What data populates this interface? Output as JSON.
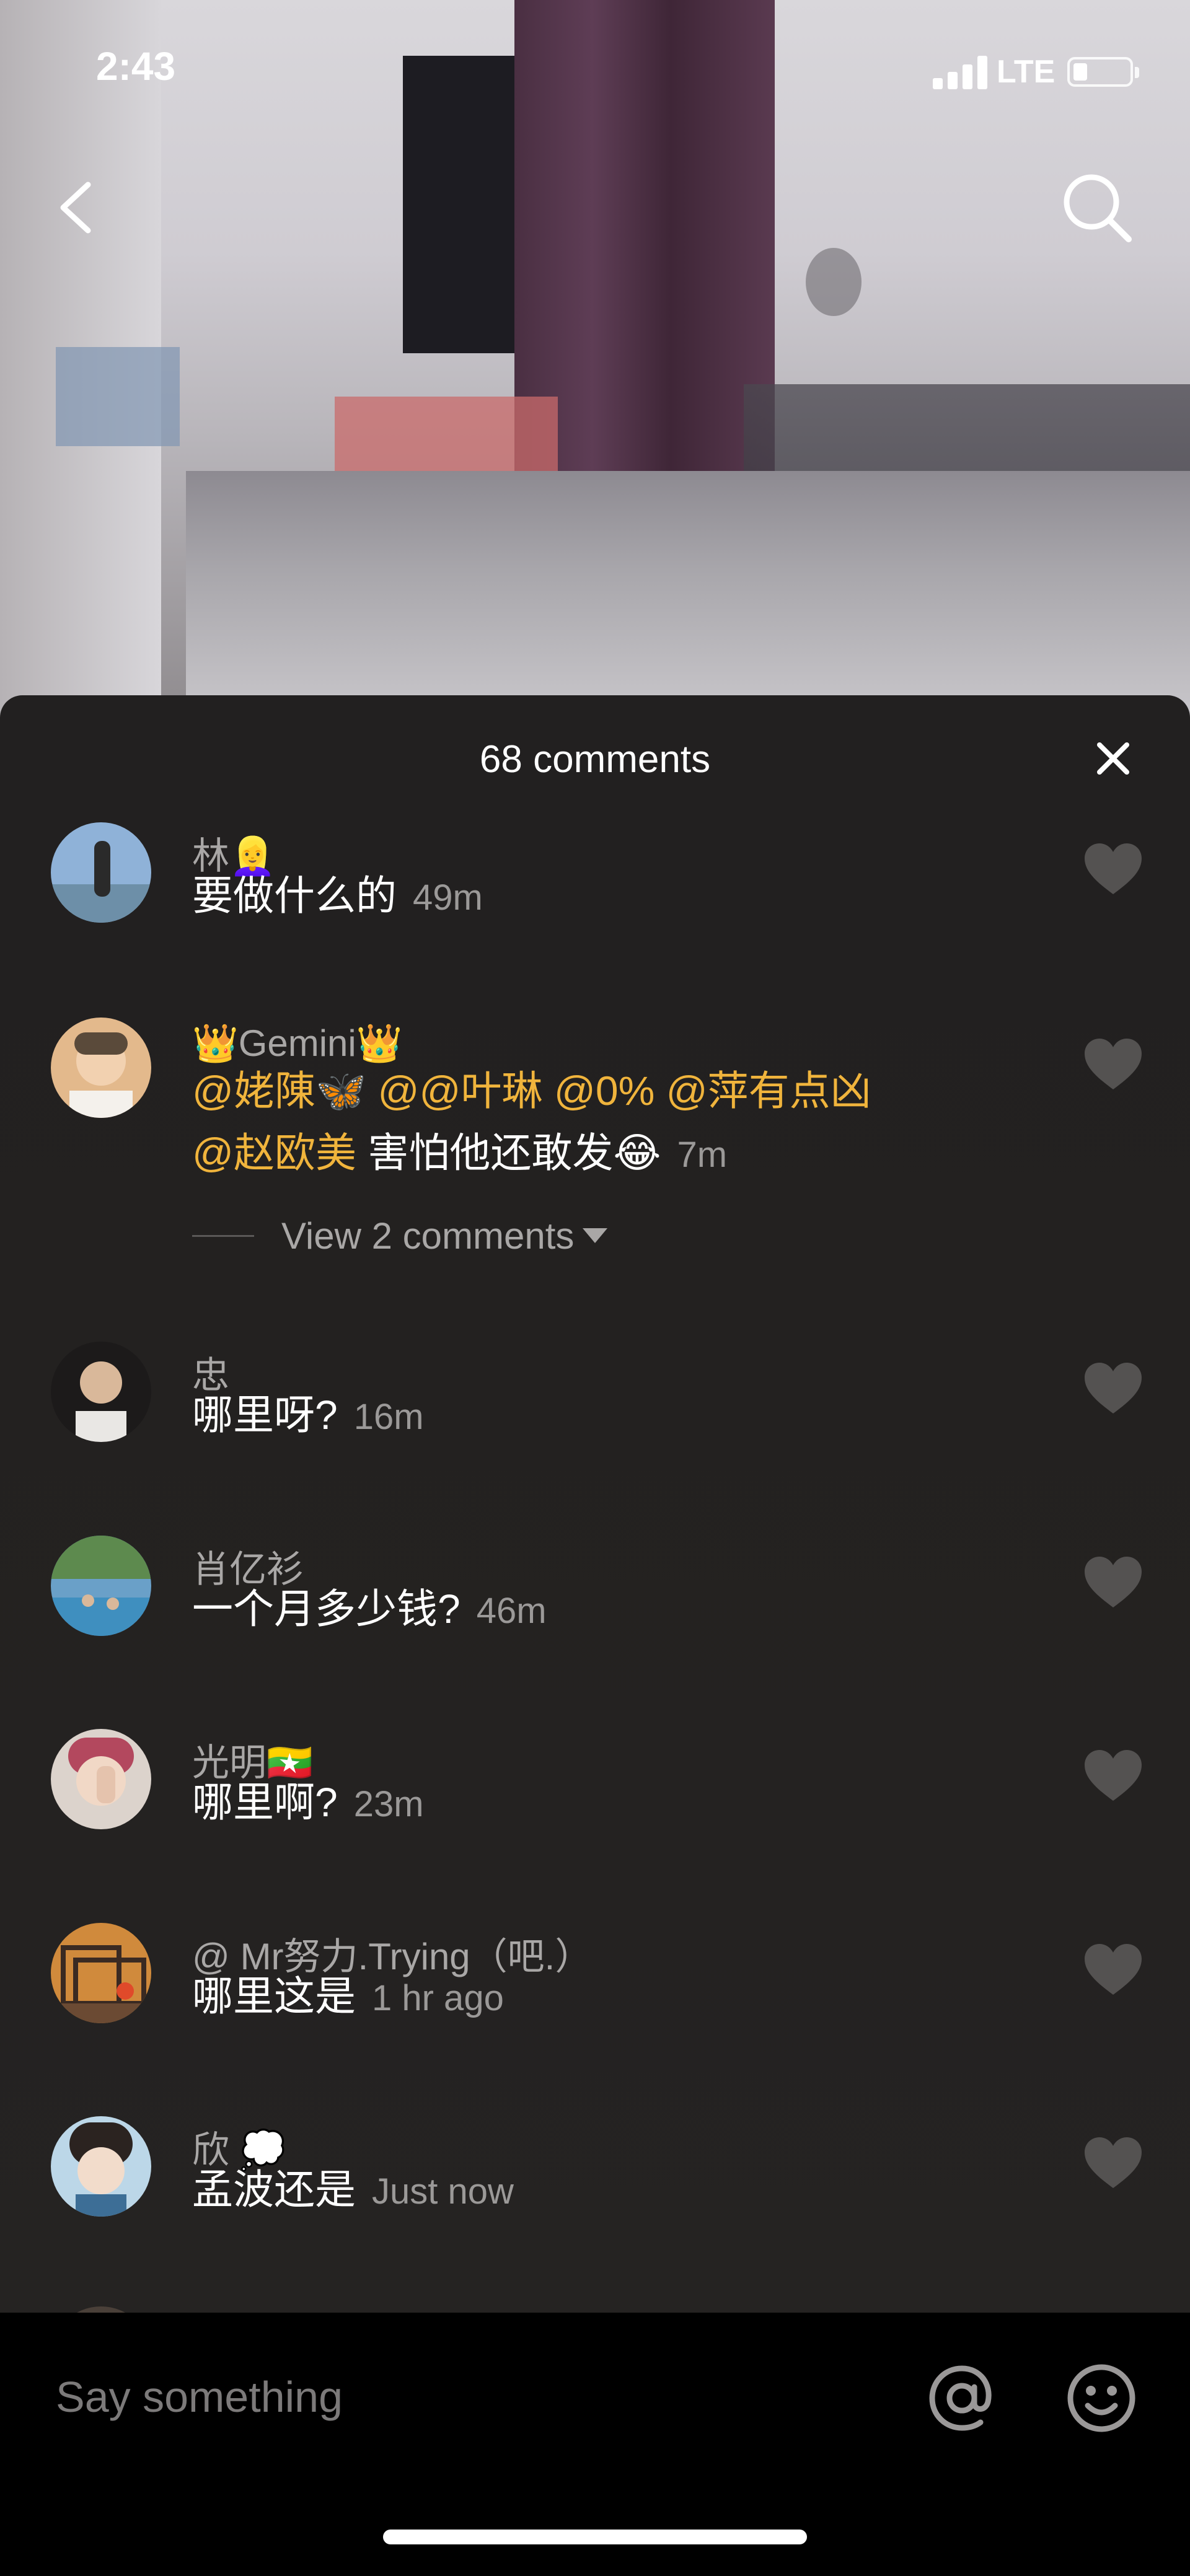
{
  "status_bar": {
    "time": "2:43",
    "network": "LTE"
  },
  "icons": {
    "back": "chevron-left-icon",
    "search": "search-icon",
    "close": "close-icon",
    "like": "heart-icon",
    "mention": "at-icon",
    "emoji": "smiley-icon"
  },
  "sheet": {
    "title": "68 comments"
  },
  "colors": {
    "mention": "#f0b43c",
    "sheet_bg": "#222020",
    "muted": "#a9a7a6"
  },
  "comments": [
    {
      "user": "林👱‍♀️",
      "text": "要做什么的",
      "time": "49m"
    },
    {
      "user": "👑Gemini👑",
      "line1": {
        "m1": "@姥陳🦋",
        "m2": "@@叶琳",
        "m3": "@0%",
        "m4": "@萍有点凶"
      },
      "line2": {
        "m1": "@赵欧美",
        "text": "害怕他还敢发😂",
        "time": "7m"
      },
      "view_more": "View 2 comments"
    },
    {
      "user": "忠",
      "text": "哪里呀?",
      "time": "16m"
    },
    {
      "user": "肖亿衫",
      "text": "一个月多少钱?",
      "time": "46m"
    },
    {
      "user": "光明🇲🇲",
      "text": "哪里啊?",
      "time": "23m"
    },
    {
      "user": "@ Mr努力.Trying（吧.）",
      "text": "哪里这是",
      "time": "1 hr ago"
    },
    {
      "user": "欣 💭",
      "text": "孟波还是",
      "time": "Just now"
    }
  ],
  "input": {
    "placeholder": "Say something"
  }
}
